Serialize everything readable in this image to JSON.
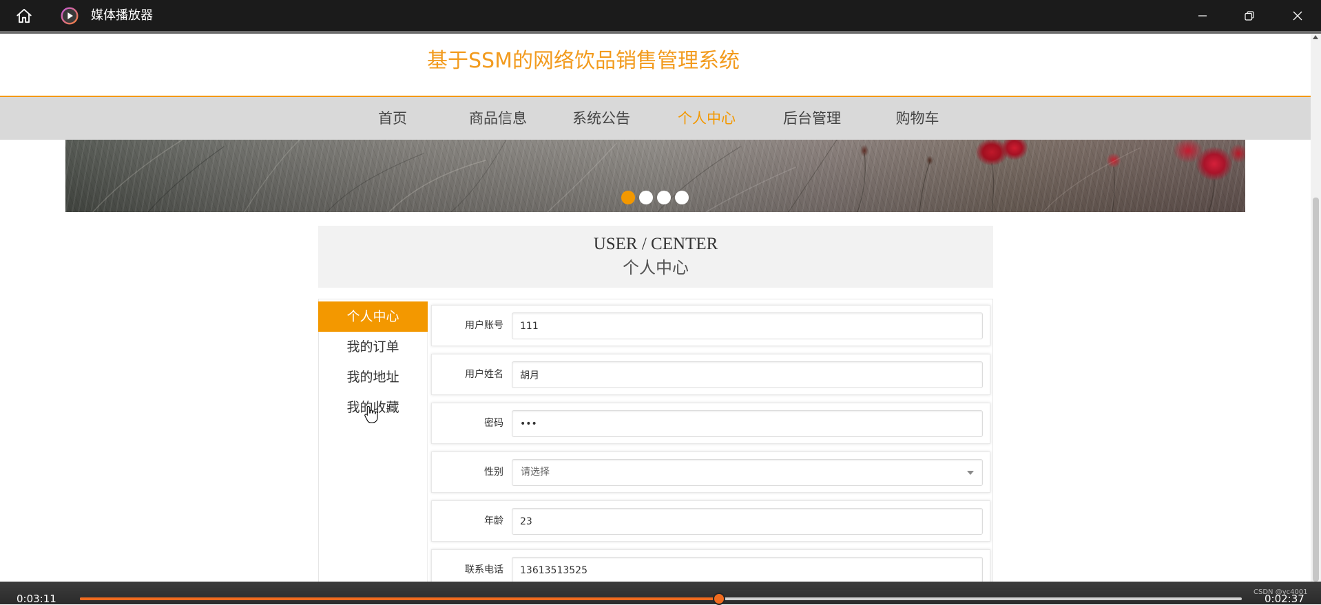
{
  "window": {
    "title": "媒体播放器"
  },
  "site": {
    "title": "基于SSM的网络饮品销售管理系统"
  },
  "nav": {
    "items": [
      {
        "label": "首页",
        "active": false
      },
      {
        "label": "商品信息",
        "active": false
      },
      {
        "label": "系统公告",
        "active": false
      },
      {
        "label": "个人中心",
        "active": true
      },
      {
        "label": "后台管理",
        "active": false
      },
      {
        "label": "购物车",
        "active": false
      }
    ]
  },
  "banner": {
    "slide_count": 4,
    "active_slide": 1
  },
  "user_center": {
    "heading_en": "USER / CENTER",
    "heading_cn": "个人中心"
  },
  "sidebar": {
    "items": [
      {
        "label": "个人中心",
        "active": true
      },
      {
        "label": "我的订单",
        "active": false
      },
      {
        "label": "我的地址",
        "active": false
      },
      {
        "label": "我的收藏",
        "active": false
      }
    ]
  },
  "form": {
    "fields": [
      {
        "label": "用户账号",
        "value": "111",
        "kind": "text"
      },
      {
        "label": "用户姓名",
        "value": "胡月",
        "kind": "text"
      },
      {
        "label": "密码",
        "value": "•••",
        "kind": "password"
      },
      {
        "label": "性别",
        "value": "请选择",
        "kind": "select"
      },
      {
        "label": "年龄",
        "value": "23",
        "kind": "text"
      },
      {
        "label": "联系电话",
        "value": "13613513525",
        "kind": "text"
      }
    ]
  },
  "player": {
    "elapsed": "0:03:11",
    "remaining": "0:02:37",
    "progress": 0.55
  },
  "watermark": "CSDN @yc4001",
  "colors": {
    "accent": "#f39800",
    "site_title": "#f29b1e",
    "nav_background": "#d9d9d9",
    "player_progress": "#f06b1f"
  },
  "icons": {
    "titlebar": [
      "home-icon",
      "media-player-app-icon",
      "minimize-icon",
      "restore-icon",
      "close-icon"
    ],
    "form": [
      "chevron-down-icon"
    ],
    "pointer": "hand-cursor-icon"
  }
}
